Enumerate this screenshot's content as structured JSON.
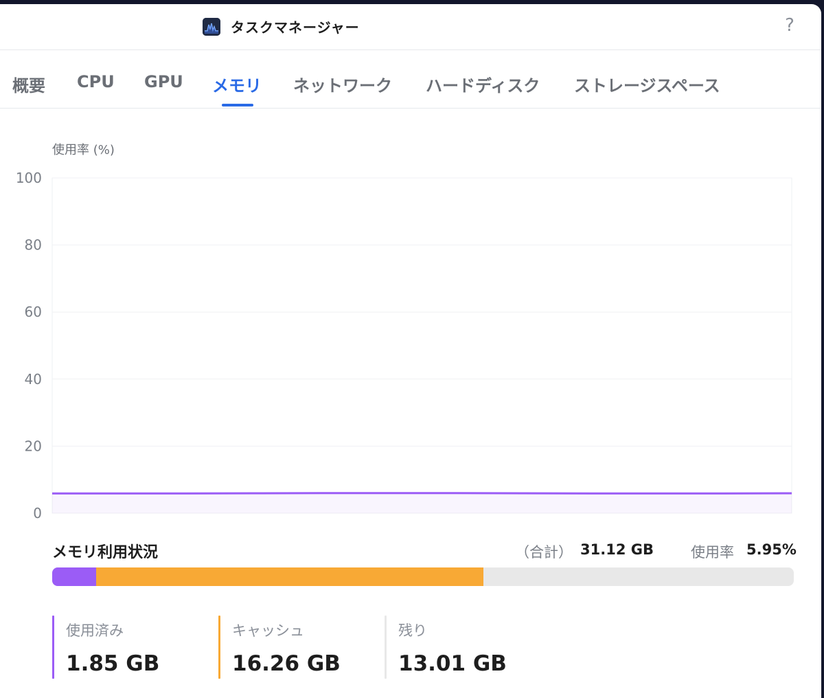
{
  "app": {
    "title": "タスクマネージャー",
    "help_label": "?",
    "icon": "activity-monitor-icon"
  },
  "tabs": [
    {
      "label": "概要",
      "active": false
    },
    {
      "label": "CPU",
      "active": false
    },
    {
      "label": "GPU",
      "active": false
    },
    {
      "label": "メモリ",
      "active": true
    },
    {
      "label": "ネットワーク",
      "active": false
    },
    {
      "label": "ハードディスク",
      "active": false
    },
    {
      "label": "ストレージスペース",
      "active": false
    }
  ],
  "chart_data": {
    "type": "area",
    "ylabel": "使用率 (%)",
    "ylim": [
      0,
      100
    ],
    "yticks": [
      "100",
      "80",
      "60",
      "40",
      "20",
      "0"
    ],
    "grid": true,
    "series": [
      {
        "color": "#9b5cf6",
        "values": [
          5.9,
          5.9,
          5.9,
          5.95,
          6.0,
          6.0,
          6.0,
          5.95,
          5.9,
          5.9,
          5.9,
          5.95
        ]
      }
    ]
  },
  "memory": {
    "title": "メモリ利用状況",
    "total_label": "（合計）",
    "total_value": "31.12 GB",
    "rate_label": "使用率",
    "rate_value": "5.95%",
    "used_fraction": 0.0594,
    "cache_fraction": 0.5225,
    "colors": {
      "used": "#9b5cf6",
      "cache": "#f8a935",
      "free": "#e8e8e8"
    },
    "stats": [
      {
        "label": "使用済み",
        "value": "1.85 GB",
        "color": "#9b5cf6"
      },
      {
        "label": "キャッシュ",
        "value": "16.26 GB",
        "color": "#f8a935"
      },
      {
        "label": "残り",
        "value": "13.01 GB",
        "color": "#e8e8e8"
      }
    ]
  }
}
